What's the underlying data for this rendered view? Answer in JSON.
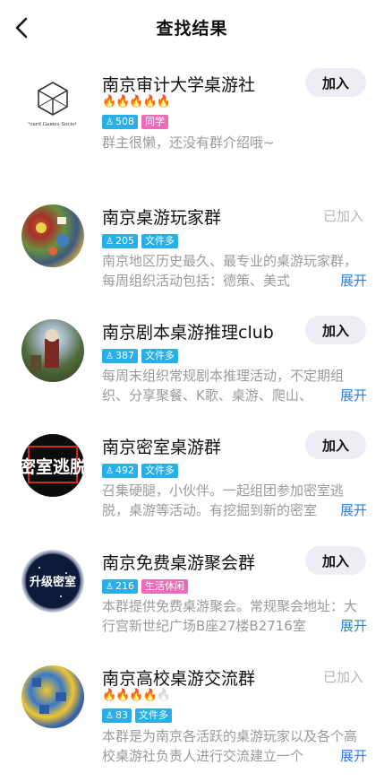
{
  "header": {
    "title": "查找结果"
  },
  "groups": [
    {
      "name": "南京审计大学桌游社",
      "flames": "🔥🔥🔥🔥🔥",
      "members": "508",
      "tags": [
        "同学"
      ],
      "desc": "群主很懒，还没有群介绍哦~",
      "expand": "",
      "action": "加入",
      "logo_text": "Board Games Society"
    },
    {
      "name": "南京桌游玩家群",
      "flames": "",
      "members": "205",
      "tags": [
        "文件多"
      ],
      "desc": "南京地区历史最久、最专业的桌游玩家群，每周组织活动包括：德策、美式",
      "expand": "展开",
      "action": "已加入"
    },
    {
      "name": "南京剧本桌游推理club",
      "flames": "",
      "members": "387",
      "tags": [
        "文件多"
      ],
      "desc": "每周末组织常规剧本推理活动，不定期组织、分享聚餐、K歌、桌游、爬山、",
      "expand": "展开",
      "action": "加入"
    },
    {
      "name": "南京密室桌游群",
      "flames": "",
      "members": "492",
      "tags": [
        "文件多"
      ],
      "desc": "召集硬腿，小伙伴。一起组团参加密室逃脱，桌游等活动。有挖掘到新的密室",
      "expand": "展开",
      "action": "加入",
      "logo_text": "密室逃脱"
    },
    {
      "name": "南京免费桌游聚会群",
      "flames": "",
      "members": "216",
      "tags": [
        "生活休闲"
      ],
      "desc": "本群提供免费桌游聚会。常规聚会地址：大行宫新世纪广场B座27楼B2716室",
      "expand": "展开",
      "action": "加入",
      "logo_text": "升级密室"
    },
    {
      "name": "南京高校桌游交流群",
      "flames": "🔥🔥🔥🔥",
      "members": "83",
      "tags": [
        "文件多"
      ],
      "desc": "本群是为南京各活跃的桌游玩家以及各个高校桌游社负责人进行交流建立一个",
      "expand": "展开",
      "action": "已加入"
    }
  ],
  "colors": {
    "tag_blue": "#29aee8",
    "tag_pink": "#ec6ab8",
    "link_blue": "#2d7fe0"
  }
}
